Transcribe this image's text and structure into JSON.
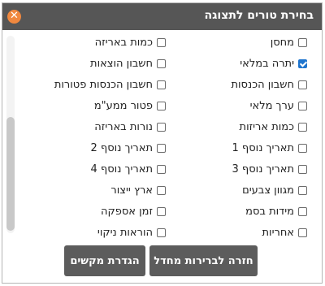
{
  "dialog": {
    "title": "בחירת טורים לתצוגה",
    "close_symbol": "✕"
  },
  "options": [
    {
      "label": "מחסן",
      "checked": false
    },
    {
      "label": "כמות באריזה",
      "checked": false
    },
    {
      "label": "יתרה במלאי",
      "checked": true
    },
    {
      "label": "חשבון הוצאות",
      "checked": false
    },
    {
      "label": "חשבון הכנסות",
      "checked": false
    },
    {
      "label": "חשבון הכנסות פטורות",
      "checked": false
    },
    {
      "label": "ערך מלאי",
      "checked": false
    },
    {
      "label": "פטור ממע\"מ",
      "checked": false
    },
    {
      "label": "כמות אריזות",
      "checked": false
    },
    {
      "label": "נורות באריזה",
      "checked": false
    },
    {
      "label": "תאריך נוסף 1",
      "checked": false
    },
    {
      "label": "תאריך נוסף 2",
      "checked": false
    },
    {
      "label": "תאריך נוסף 3",
      "checked": false
    },
    {
      "label": "תאריך נוסף 4",
      "checked": false
    },
    {
      "label": "מגוון צבעים",
      "checked": false
    },
    {
      "label": "ארץ ייצור",
      "checked": false
    },
    {
      "label": "מידות בסמ",
      "checked": false
    },
    {
      "label": "זמן אספקה",
      "checked": false
    },
    {
      "label": "אחריות",
      "checked": false
    },
    {
      "label": "הוראות ניקוי",
      "checked": false
    }
  ],
  "buttons": {
    "reset_label": "חזרה לברירות מחדל",
    "defaults_label": "הגדרת מקשים"
  }
}
